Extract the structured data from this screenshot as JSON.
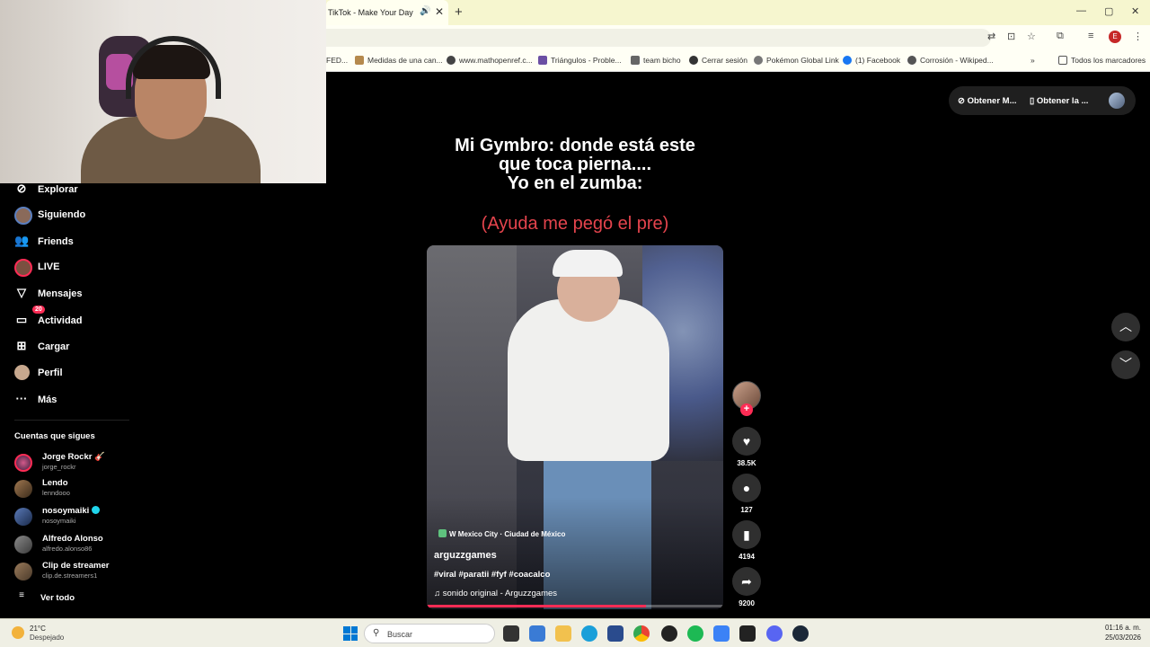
{
  "browser": {
    "tab_title": "TikTok - Make Your Day",
    "tab_audio_icon": "speaker-icon",
    "tab_close": "✕",
    "new_tab": "+",
    "window_controls": [
      "—",
      "▢",
      "✕"
    ],
    "profile_initial": "E",
    "bookmarks": [
      {
        "label": "FED...",
        "icon": "folder-icon"
      },
      {
        "label": "Medidas de una can...",
        "icon": "favicon"
      },
      {
        "label": "www.mathopenref.c...",
        "icon": "favicon"
      },
      {
        "label": "Triángulos - Proble...",
        "icon": "favicon"
      },
      {
        "label": "team bicho",
        "icon": "favicon"
      },
      {
        "label": "Cerrar sesión",
        "icon": "favicon"
      },
      {
        "label": "Pokémon Global Link",
        "icon": "favicon"
      },
      {
        "label": "(1) Facebook",
        "icon": "facebook-icon"
      },
      {
        "label": "Corrosión - Wikiped...",
        "icon": "wikipedia-icon"
      }
    ],
    "bookmarks_overflow": "»",
    "all_bookmarks": "Todos los marcadores"
  },
  "sidebar": {
    "nav": [
      {
        "label": "Explorar",
        "icon": "compass-icon"
      },
      {
        "label": "Siguiendo",
        "icon": "following-avatar-icon"
      },
      {
        "label": "Friends",
        "icon": "friends-icon"
      },
      {
        "label": "LIVE",
        "icon": "live-icon"
      },
      {
        "label": "Mensajes",
        "icon": "messages-icon"
      },
      {
        "label": "Actividad",
        "icon": "activity-icon",
        "badge": "20"
      },
      {
        "label": "Cargar",
        "icon": "upload-icon"
      },
      {
        "label": "Perfil",
        "icon": "profile-icon"
      },
      {
        "label": "Más",
        "icon": "more-icon"
      }
    ],
    "following_title": "Cuentas que sigues",
    "accounts": [
      {
        "name": "Jorge Rockr",
        "handle": "jorge_rockr",
        "suffix": "🎸"
      },
      {
        "name": "Lendo",
        "handle": "lenndooo"
      },
      {
        "name": "nosoymaiki",
        "handle": "nosoymaiki",
        "verified": true
      },
      {
        "name": "Alfredo Alonso",
        "handle": "alfredo.alonso86"
      },
      {
        "name": "Clip de streamer",
        "handle": "clip.de.streamers1"
      }
    ],
    "see_all": "Ver todo"
  },
  "topbar": {
    "get_coins": "Obtener M...",
    "get_app": "Obtener la ..."
  },
  "video": {
    "caption_lines": [
      "Mi Gymbro: donde está este",
      "que toca pierna....",
      "Yo en el zumba:"
    ],
    "caption_red": "(Ayuda me pegó el pre)",
    "location": "W Mexico City · Ciudad de México",
    "author": "arguzzgames",
    "hashtags": "#viral #paratii #fyf #coacalco",
    "sound": "sonido original - Arguzzgames",
    "progress": 0.74,
    "stats": {
      "likes": "38.5K",
      "comments": "127",
      "saves": "4194",
      "shares": "9200"
    }
  },
  "taskbar": {
    "temperature": "21°C",
    "condition": "Despejado",
    "search_placeholder": "Buscar",
    "time": "01:16 a. m.",
    "date": "25/03/2026"
  },
  "colors": {
    "accent": "#fe2c55",
    "caption_red": "#e5444d",
    "background": "#000000"
  }
}
